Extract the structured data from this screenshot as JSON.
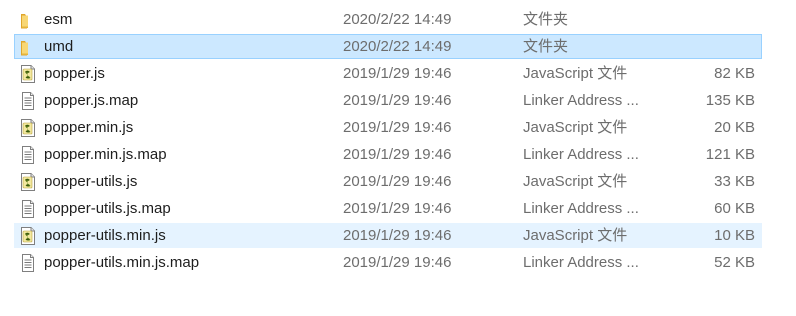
{
  "files": [
    {
      "name": "esm",
      "date": "2020/2/22 14:49",
      "type": "文件夹",
      "size": "",
      "icon": "folder-icon",
      "state": "normal"
    },
    {
      "name": "umd",
      "date": "2020/2/22 14:49",
      "type": "文件夹",
      "size": "",
      "icon": "folder-icon",
      "state": "selected"
    },
    {
      "name": "popper.js",
      "date": "2019/1/29 19:46",
      "type": "JavaScript 文件",
      "size": "82 KB",
      "icon": "js-file-icon",
      "state": "normal"
    },
    {
      "name": "popper.js.map",
      "date": "2019/1/29 19:46",
      "type": "Linker Address ...",
      "size": "135 KB",
      "icon": "text-file-icon",
      "state": "normal"
    },
    {
      "name": "popper.min.js",
      "date": "2019/1/29 19:46",
      "type": "JavaScript 文件",
      "size": "20 KB",
      "icon": "js-file-icon",
      "state": "normal"
    },
    {
      "name": "popper.min.js.map",
      "date": "2019/1/29 19:46",
      "type": "Linker Address ...",
      "size": "121 KB",
      "icon": "text-file-icon",
      "state": "normal"
    },
    {
      "name": "popper-utils.js",
      "date": "2019/1/29 19:46",
      "type": "JavaScript 文件",
      "size": "33 KB",
      "icon": "js-file-icon",
      "state": "normal"
    },
    {
      "name": "popper-utils.js.map",
      "date": "2019/1/29 19:46",
      "type": "Linker Address ...",
      "size": "60 KB",
      "icon": "text-file-icon",
      "state": "normal"
    },
    {
      "name": "popper-utils.min.js",
      "date": "2019/1/29 19:46",
      "type": "JavaScript 文件",
      "size": "10 KB",
      "icon": "js-file-icon",
      "state": "hover"
    },
    {
      "name": "popper-utils.min.js.map",
      "date": "2019/1/29 19:46",
      "type": "Linker Address ...",
      "size": "52 KB",
      "icon": "text-file-icon",
      "state": "normal"
    }
  ],
  "colors": {
    "selected_bg": "#cce8ff",
    "selected_border": "#99d1ff",
    "hover_bg": "#e5f3ff",
    "folder": "#f8d775"
  }
}
